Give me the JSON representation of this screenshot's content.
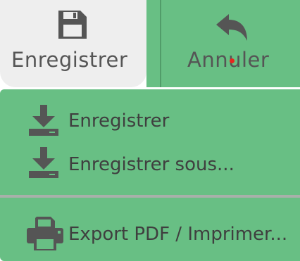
{
  "toolbar": {
    "save_label": "Enregistrer",
    "undo_label": "Annuler"
  },
  "menu": {
    "items": [
      {
        "label": "Enregistrer",
        "icon": "download-icon"
      },
      {
        "label": "Enregistrer sous...",
        "icon": "download-icon"
      },
      {
        "label": "Export PDF / Imprimer...",
        "icon": "printer-icon"
      }
    ]
  },
  "colors": {
    "accent_green": "#68bf84",
    "selected_bg": "#eeeeee",
    "icon_dark": "#555555",
    "cursor_dot": "#e8261e"
  }
}
